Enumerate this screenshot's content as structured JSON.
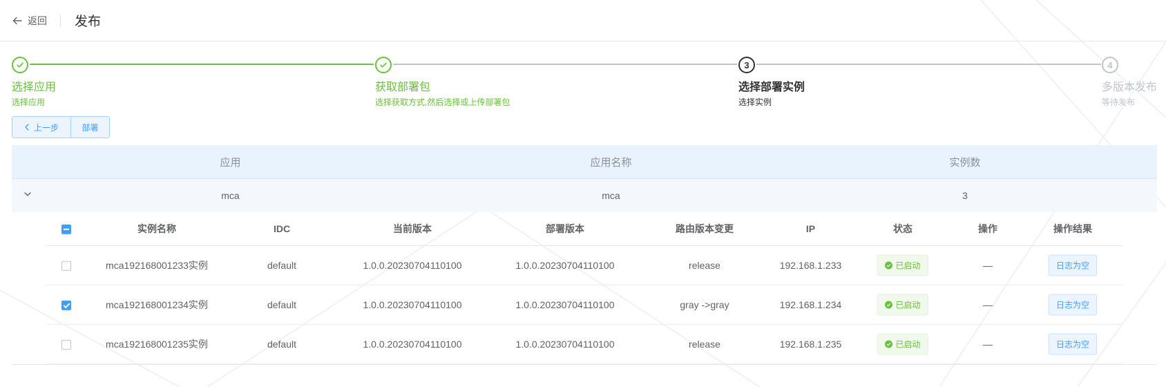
{
  "header": {
    "back_label": "返回",
    "title": "发布"
  },
  "steps": [
    {
      "title": "选择应用",
      "desc": "选择应用",
      "status": "done"
    },
    {
      "title": "获取部署包",
      "desc": "选择获取方式,然后选择或上传部署包",
      "status": "done"
    },
    {
      "title": "选择部署实例",
      "desc": "选择实例",
      "status": "active",
      "number": "3"
    },
    {
      "title": "多版本发布",
      "desc": "等待发布",
      "status": "wait",
      "number": "4"
    }
  ],
  "actions": {
    "prev_label": "上一步",
    "deploy_label": "部署"
  },
  "outer_table": {
    "headers": [
      "应用",
      "应用名称",
      "实例数"
    ],
    "row": {
      "app": "mca",
      "app_name": "mca",
      "instance_count": "3"
    }
  },
  "inner_table": {
    "headers": [
      "实例名称",
      "IDC",
      "当前版本",
      "部署版本",
      "路由版本变更",
      "IP",
      "状态",
      "操作",
      "操作结果"
    ],
    "rows": [
      {
        "checked": false,
        "name": "mca192168001233实例",
        "idc": "default",
        "current_version": "1.0.0.20230704110100",
        "deploy_version": "1.0.0.20230704110100",
        "route_change": "release",
        "ip": "192.168.1.233",
        "status": "已启动",
        "op": "—",
        "result": "日志为空"
      },
      {
        "checked": true,
        "name": "mca192168001234实例",
        "idc": "default",
        "current_version": "1.0.0.20230704110100",
        "deploy_version": "1.0.0.20230704110100",
        "route_change": "gray ->gray",
        "ip": "192.168.1.234",
        "status": "已启动",
        "op": "—",
        "result": "日志为空"
      },
      {
        "checked": false,
        "name": "mca192168001235实例",
        "idc": "default",
        "current_version": "1.0.0.20230704110100",
        "deploy_version": "1.0.0.20230704110100",
        "route_change": "release",
        "ip": "192.168.1.235",
        "status": "已启动",
        "op": "—",
        "result": "日志为空"
      }
    ]
  },
  "colors": {
    "success": "#67c23a",
    "primary": "#409eff",
    "header_bg": "#e8f3fe"
  }
}
